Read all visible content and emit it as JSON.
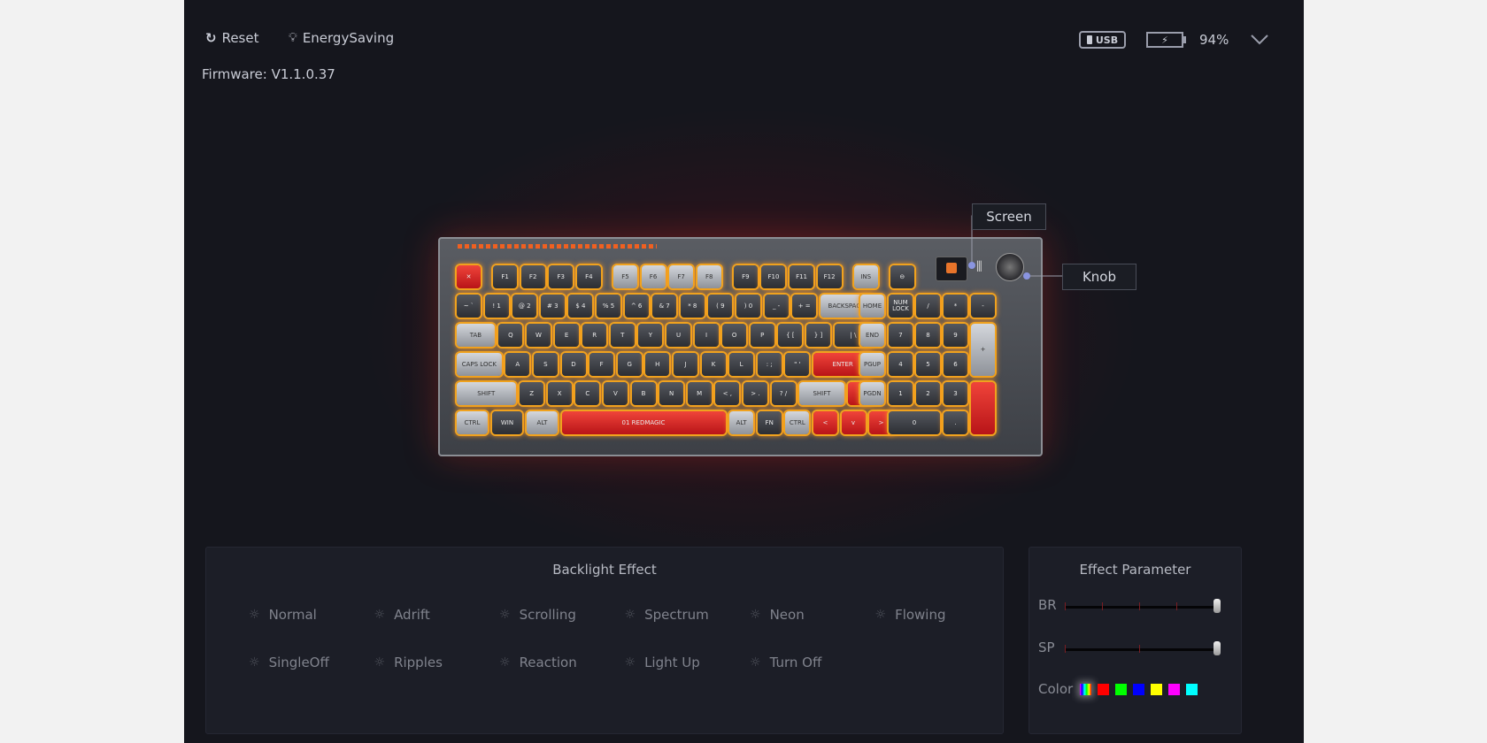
{
  "toolbar": {
    "reset_label": "Reset",
    "energy_label": "EnergySaving",
    "firmware": "Firmware: V1.1.0.37"
  },
  "status": {
    "connection": "USB",
    "battery": "94%",
    "battery_level_percent": 94
  },
  "callouts": {
    "screen": "Screen",
    "knob": "Knob"
  },
  "keyboard": {
    "brand": "REDMAGIC",
    "rows": [
      [
        [
          "✕",
          1,
          "red",
          0
        ],
        [
          "F1",
          1,
          "dark",
          0.3
        ],
        [
          "F2",
          1,
          "dark",
          0
        ],
        [
          "F3",
          1,
          "dark",
          0
        ],
        [
          "F4",
          1,
          "dark",
          0
        ],
        [
          "F5",
          1,
          "light",
          0.3
        ],
        [
          "F6",
          1,
          "light",
          0
        ],
        [
          "F7",
          1,
          "light",
          0
        ],
        [
          "F8",
          1,
          "light",
          0
        ],
        [
          "F9",
          1,
          "dark",
          0.3
        ],
        [
          "F10",
          1,
          "dark",
          0
        ],
        [
          "F11",
          1,
          "dark",
          0
        ],
        [
          "F12",
          1,
          "dark",
          0
        ],
        [
          "INS",
          1,
          "light",
          0.3
        ],
        [
          "⊖",
          1,
          "dark",
          0.3
        ]
      ],
      [
        [
          "~ `",
          1,
          "dark",
          0
        ],
        [
          "! 1",
          1,
          "dark",
          0
        ],
        [
          "@ 2",
          1,
          "dark",
          0
        ],
        [
          "# 3",
          1,
          "dark",
          0
        ],
        [
          "$ 4",
          1,
          "dark",
          0
        ],
        [
          "% 5",
          1,
          "dark",
          0
        ],
        [
          "^ 6",
          1,
          "dark",
          0
        ],
        [
          "& 7",
          1,
          "dark",
          0
        ],
        [
          "* 8",
          1,
          "dark",
          0
        ],
        [
          "( 9",
          1,
          "dark",
          0
        ],
        [
          ") 0",
          1,
          "dark",
          0
        ],
        [
          "_ -",
          1,
          "dark",
          0
        ],
        [
          "+ =",
          1,
          "dark",
          0
        ],
        [
          "BACKSPACE",
          2,
          "light",
          0
        ]
      ],
      [
        [
          "TAB",
          1.5,
          "light",
          0
        ],
        [
          "Q",
          1,
          "dark",
          0
        ],
        [
          "W",
          1,
          "dark",
          0
        ],
        [
          "E",
          1,
          "dark",
          0
        ],
        [
          "R",
          1,
          "dark",
          0
        ],
        [
          "T",
          1,
          "dark",
          0
        ],
        [
          "Y",
          1,
          "dark",
          0
        ],
        [
          "U",
          1,
          "dark",
          0
        ],
        [
          "I",
          1,
          "dark",
          0
        ],
        [
          "O",
          1,
          "dark",
          0
        ],
        [
          "P",
          1,
          "dark",
          0
        ],
        [
          "{ [",
          1,
          "dark",
          0
        ],
        [
          "} ]",
          1,
          "dark",
          0
        ],
        [
          "| \\",
          1.5,
          "dark",
          0
        ]
      ],
      [
        [
          "CAPS LOCK",
          1.75,
          "light",
          0
        ],
        [
          "A",
          1,
          "dark",
          0
        ],
        [
          "S",
          1,
          "dark",
          0
        ],
        [
          "D",
          1,
          "dark",
          0
        ],
        [
          "F",
          1,
          "dark",
          0
        ],
        [
          "G",
          1,
          "dark",
          0
        ],
        [
          "H",
          1,
          "dark",
          0
        ],
        [
          "J",
          1,
          "dark",
          0
        ],
        [
          "K",
          1,
          "dark",
          0
        ],
        [
          "L",
          1,
          "dark",
          0
        ],
        [
          ": ;",
          1,
          "dark",
          0
        ],
        [
          "\" '",
          1,
          "dark",
          0
        ],
        [
          "ENTER",
          2.25,
          "red",
          0
        ]
      ],
      [
        [
          "SHIFT",
          2.25,
          "light",
          0
        ],
        [
          "Z",
          1,
          "dark",
          0
        ],
        [
          "X",
          1,
          "dark",
          0
        ],
        [
          "C",
          1,
          "dark",
          0
        ],
        [
          "V",
          1,
          "dark",
          0
        ],
        [
          "B",
          1,
          "dark",
          0
        ],
        [
          "N",
          1,
          "dark",
          0
        ],
        [
          "M",
          1,
          "dark",
          0
        ],
        [
          "< ,",
          1,
          "dark",
          0
        ],
        [
          "> .",
          1,
          "dark",
          0
        ],
        [
          "? /",
          1,
          "dark",
          0
        ],
        [
          "SHIFT",
          1.75,
          "light",
          0
        ],
        [
          "^",
          1,
          "red",
          0
        ]
      ],
      [
        [
          "CTRL",
          1.25,
          "light",
          0
        ],
        [
          "WIN",
          1.25,
          "dark",
          0
        ],
        [
          "ALT",
          1.25,
          "light",
          0
        ],
        [
          "01  REDMAGIC",
          6,
          "red",
          0
        ],
        [
          "ALT",
          1,
          "light",
          0
        ],
        [
          "FN",
          1,
          "dark",
          0
        ],
        [
          "CTRL",
          1,
          "light",
          0
        ],
        [
          "<",
          1,
          "red",
          0
        ],
        [
          "v",
          1,
          "red",
          0
        ],
        [
          ">",
          1,
          "red",
          0
        ]
      ]
    ],
    "nav": [
      "HOME",
      "END",
      "PGUP",
      "PGDN"
    ],
    "numpad": [
      [
        [
          "NUM LOCK",
          1
        ],
        [
          "/",
          1
        ],
        [
          "*",
          1
        ],
        [
          "-",
          1
        ]
      ],
      [
        [
          "7",
          1
        ],
        [
          "8",
          1
        ],
        [
          "9",
          1
        ]
      ],
      [
        [
          "4",
          1
        ],
        [
          "5",
          1
        ],
        [
          "6",
          1
        ]
      ],
      [
        [
          "1",
          1
        ],
        [
          "2",
          1
        ],
        [
          "3",
          1
        ]
      ],
      [
        [
          "0",
          2
        ],
        [
          ".",
          1
        ]
      ]
    ],
    "numpad_plus": "+"
  },
  "backlight": {
    "title": "Backlight Effect",
    "effects": [
      "Normal",
      "Adrift",
      "Scrolling",
      "Spectrum",
      "Neon",
      "Flowing",
      "SingleOff",
      "Ripples",
      "Reaction",
      "Light Up",
      "Turn Off"
    ]
  },
  "parameters": {
    "title": "Effect Parameter",
    "brightness": {
      "label": "BR",
      "value_percent": 100,
      "steps": 5
    },
    "speed": {
      "label": "SP",
      "value_percent": 100,
      "steps": 3
    },
    "color_label": "Color",
    "colors": [
      "rainbow",
      "#ff0000",
      "#00ff00",
      "#0000ff",
      "#ffff00",
      "#ff00ff",
      "#00ffff"
    ],
    "selected_color": "rainbow"
  }
}
